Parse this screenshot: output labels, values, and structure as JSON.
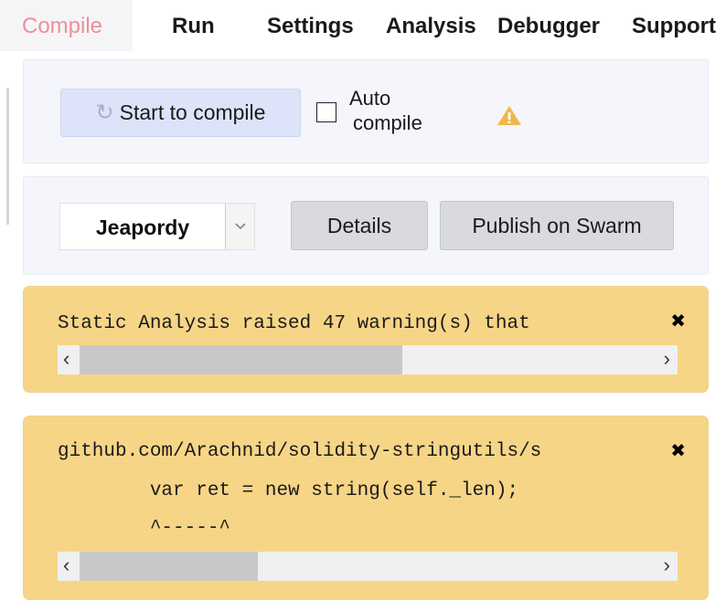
{
  "tabs": [
    "Compile",
    "Run",
    "Settings",
    "Analysis",
    "Debugger",
    "Support"
  ],
  "compile": {
    "button_label": "Start to compile",
    "auto_compile_line1": "Auto",
    "auto_compile_line2": "compile",
    "auto_compile_checked": false
  },
  "contract": {
    "selected": "Jeapordy",
    "details_label": "Details",
    "swarm_label": "Publish on Swarm"
  },
  "alerts": [
    {
      "lines": [
        "Static Analysis raised 47 warning(s) that"
      ],
      "scroll_fraction": 0.56
    },
    {
      "lines": [
        "github.com/Arachnid/solidity-stringutils/s",
        "        var ret = new string(self._len);",
        "        ^-----^"
      ],
      "scroll_fraction": 0.31
    }
  ],
  "colors": {
    "active_tab": "#f08e96",
    "alert_bg": "#f7d587",
    "warning_icon": "#f0b84a"
  },
  "icons": {
    "refresh": "refresh-icon",
    "warning": "warning-icon",
    "close": "close-icon",
    "dropdown": "chevron-down-icon"
  }
}
